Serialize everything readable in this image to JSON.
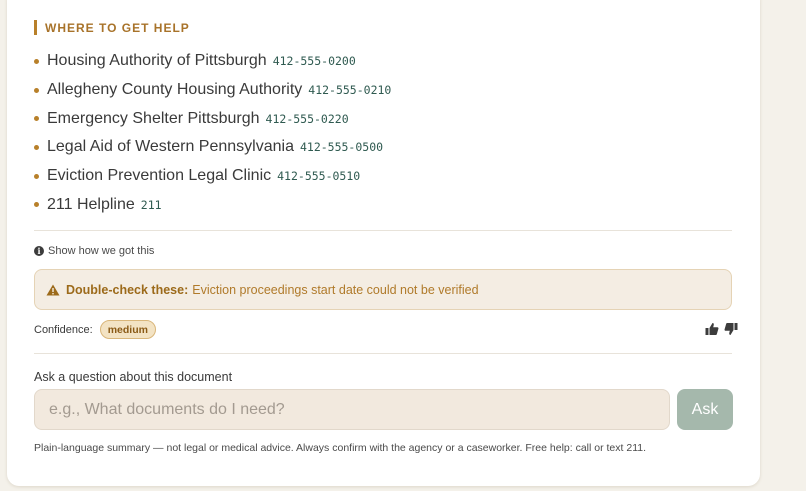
{
  "help_section": {
    "title": "WHERE TO GET HELP",
    "items": [
      {
        "name": "Housing Authority of Pittsburgh",
        "phone": "412-555-0200"
      },
      {
        "name": "Allegheny County Housing Authority",
        "phone": "412-555-0210"
      },
      {
        "name": "Emergency Shelter Pittsburgh",
        "phone": "412-555-0220"
      },
      {
        "name": "Legal Aid of Western Pennsylvania",
        "phone": "412-555-0500"
      },
      {
        "name": "Eviction Prevention Legal Clinic",
        "phone": "412-555-0510"
      },
      {
        "name": "211 Helpline",
        "phone": "211"
      }
    ]
  },
  "how_link": "Show how we got this",
  "warning": {
    "label": "Double-check these:",
    "text": "Eviction proceedings start date could not be verified"
  },
  "confidence": {
    "label": "Confidence:",
    "level": "medium"
  },
  "ask": {
    "label": "Ask a question about this document",
    "placeholder": "e.g., What documents do I need?",
    "button": "Ask"
  },
  "disclaimer": "Plain-language summary — not legal or medical advice. Always confirm with the agency or a caseworker. Free help: call or text 211.",
  "colors": {
    "accent": "#b8802a",
    "phone": "#2f5a50",
    "ask_button": "#a5b8ac",
    "warning_bg": "#f4ede3"
  },
  "icons": {
    "info": "info-icon",
    "warning": "warning-icon",
    "thumbs_up": "thumbs-up-icon",
    "thumbs_down": "thumbs-down-icon"
  }
}
